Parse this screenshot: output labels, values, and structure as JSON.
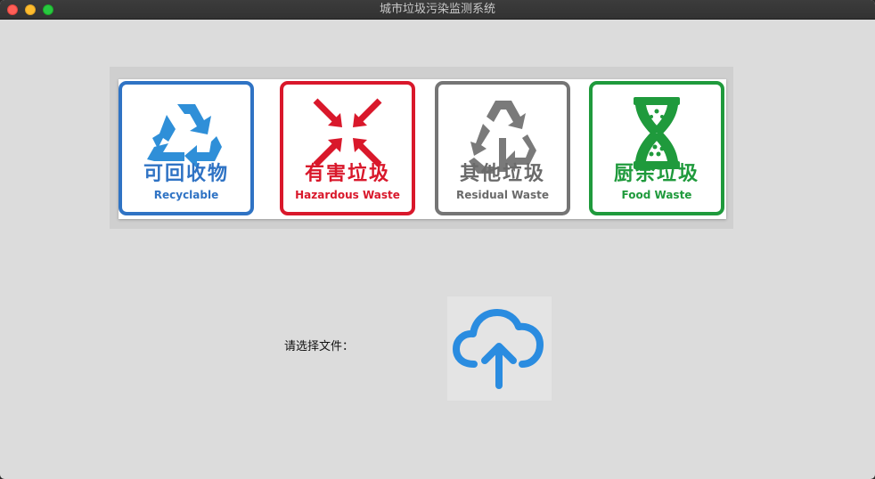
{
  "window": {
    "title": "城市垃圾污染监测系统"
  },
  "banner": {
    "bins": [
      {
        "cn": "可回收物",
        "en": "Recyclable",
        "icon": "recycle-icon",
        "color": "#2f73c4"
      },
      {
        "cn": "有害垃圾",
        "en": "Hazardous Waste",
        "icon": "hazard-arrows-icon",
        "color": "#d9182b"
      },
      {
        "cn": "其他垃圾",
        "en": "Residual Waste",
        "icon": "residual-recycle-icon",
        "color": "#757575"
      },
      {
        "cn": "厨余垃圾",
        "en": "Food Waste",
        "icon": "hourglass-icon",
        "color": "#1f9a3c"
      }
    ]
  },
  "form": {
    "file_label": "请选择文件：",
    "upload_icon": "cloud-upload-icon",
    "upload_color": "#2a8ce0"
  }
}
